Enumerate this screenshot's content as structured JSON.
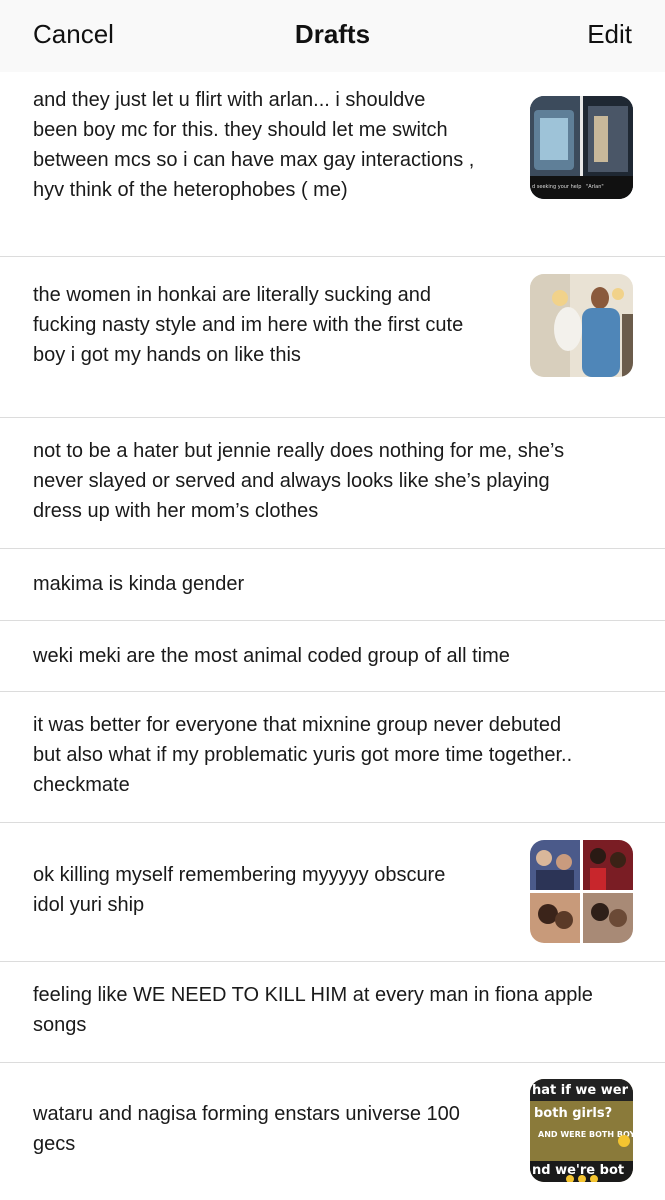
{
  "nav": {
    "cancel_label": "Cancel",
    "title": "Drafts",
    "edit_label": "Edit"
  },
  "drafts": [
    {
      "text": "and they just let u flirt with arlan... i shouldve\nbeen boy mc for this. they should let me switch\nbetween mcs so i can have max gay interactions ,\nhyv think of the heterophobes ( me)",
      "has_thumbnail": true
    },
    {
      "text": "the women in honkai are literally sucking and\nfucking nasty style and im here with the first cute\nboy i got my hands on like this",
      "has_thumbnail": true
    },
    {
      "text": "not to be a hater but jennie really does nothing for me, she’s\nnever slayed or served and always looks like she’s playing\ndress up with her mom’s clothes",
      "has_thumbnail": false
    },
    {
      "text": "makima is kinda gender",
      "has_thumbnail": false
    },
    {
      "text": "weki meki are the most animal coded group of all time",
      "has_thumbnail": false
    },
    {
      "text": "it was better for everyone that mixnine group never debuted\nbut also what if my problematic yuris got more time together..\ncheckmate",
      "has_thumbnail": false
    },
    {
      "text": "ok killing myself remembering myyyyy obscure\nidol yuri ship",
      "has_thumbnail": true
    },
    {
      "text": "feeling like WE NEED TO KILL HIM at every man in fiona apple\nsongs",
      "has_thumbnail": false
    },
    {
      "text": "wataru and nagisa forming enstars universe 100\ngecs",
      "has_thumbnail": true
    }
  ],
  "thumbnails": {
    "t1_caption_left": "d seeking your help",
    "t1_caption_right": "\"Arlan\"",
    "t4_line1": "hat if we wer",
    "t4_line2": "both girls?",
    "t4_line3": "AND WERE BOTH BOYS",
    "t4_line4": "nd we're bot"
  }
}
